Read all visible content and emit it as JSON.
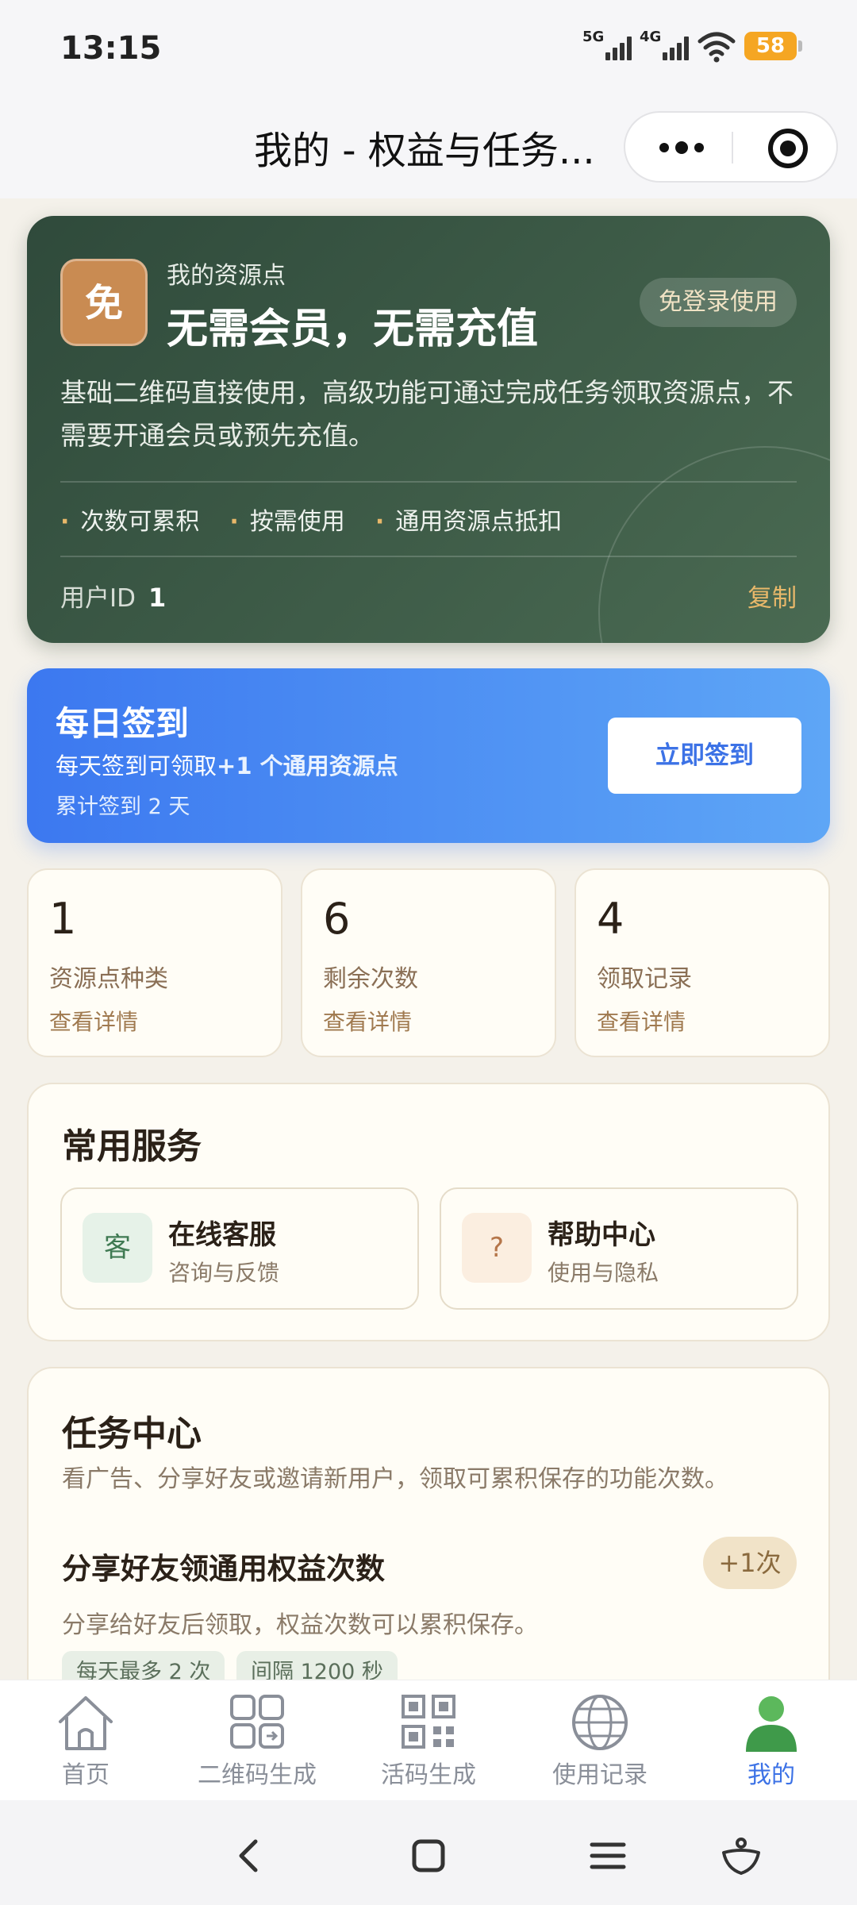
{
  "status": {
    "time": "13:15",
    "net1": "5G",
    "net2": "4G",
    "battery": "58"
  },
  "header": {
    "title": "我的 - 权益与任务..."
  },
  "hero": {
    "badge": "免",
    "small_title": "我的资源点",
    "big_title": "无需会员，无需充值",
    "pill": "免登录使用",
    "desc": "基础二维码直接使用，高级功能可通过完成任务领取资源点，不需要开通会员或预先充值。",
    "features": [
      "次数可累积",
      "按需使用",
      "通用资源点抵扣"
    ],
    "uid_label": "用户ID",
    "uid_value": "1",
    "copy": "复制"
  },
  "signin": {
    "title": "每日签到",
    "desc_prefix": "每天签到可领取",
    "desc_bold": "+1 个通用资源点",
    "total": "累计签到 2 天",
    "button": "立即签到"
  },
  "stats": [
    {
      "num": "1",
      "label": "资源点种类",
      "link": "查看详情"
    },
    {
      "num": "6",
      "label": "剩余次数",
      "link": "查看详情"
    },
    {
      "num": "4",
      "label": "领取记录",
      "link": "查看详情"
    }
  ],
  "services": {
    "title": "常用服务",
    "items": [
      {
        "icon": "客",
        "name": "在线客服",
        "sub": "咨询与反馈"
      },
      {
        "icon": "?",
        "name": "帮助中心",
        "sub": "使用与隐私"
      }
    ]
  },
  "tasks": {
    "title": "任务中心",
    "subtitle": "看广告、分享好友或邀请新用户，领取可累积保存的功能次数。",
    "item": {
      "title": "分享好友领通用权益次数",
      "badge": "+1次",
      "desc": "分享给好友后领取，权益次数可以累积保存。",
      "tags": [
        "每天最多 2 次",
        "间隔 1200 秒"
      ]
    }
  },
  "tabbar": {
    "items": [
      {
        "label": "首页",
        "icon": "home-icon"
      },
      {
        "label": "二维码生成",
        "icon": "qr-generate-icon"
      },
      {
        "label": "活码生成",
        "icon": "qrcode-icon"
      },
      {
        "label": "使用记录",
        "icon": "globe-icon"
      },
      {
        "label": "我的",
        "icon": "user-icon"
      }
    ],
    "active_color": "#3c72e6"
  }
}
